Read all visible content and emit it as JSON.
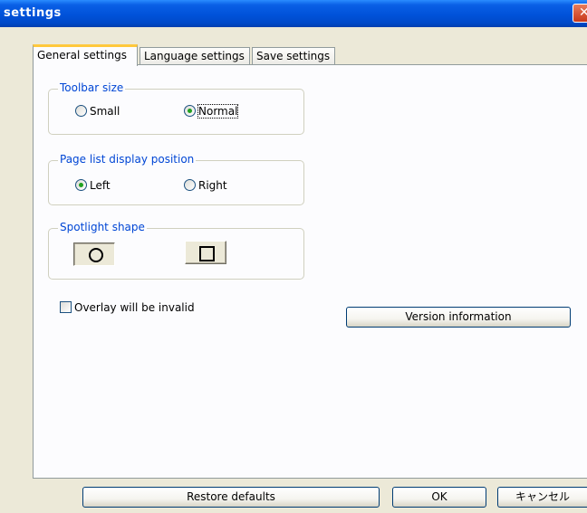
{
  "window": {
    "title": "settings",
    "close_glyph": "✕"
  },
  "tabs": [
    {
      "label": "General settings",
      "active": true
    },
    {
      "label": "Language settings",
      "active": false
    },
    {
      "label": "Save settings",
      "active": false
    }
  ],
  "toolbar_size": {
    "legend": "Toolbar size",
    "options": [
      {
        "label": "Small",
        "selected": false
      },
      {
        "label": "Normal",
        "selected": true
      }
    ]
  },
  "page_list_position": {
    "legend": "Page list display position",
    "options": [
      {
        "label": "Left",
        "selected": true
      },
      {
        "label": "Right",
        "selected": false
      }
    ]
  },
  "spotlight_shape": {
    "legend": "Spotlight shape",
    "options": [
      {
        "shape": "circle-icon",
        "selected": true
      },
      {
        "shape": "square-icon",
        "selected": false
      }
    ]
  },
  "overlay_checkbox": {
    "label": "Overlay will be invalid",
    "checked": false
  },
  "buttons": {
    "version_info": "Version information",
    "restore_defaults": "Restore defaults",
    "ok": "OK",
    "cancel": "キャンセル"
  },
  "colors": {
    "titlebar": "#0052d9",
    "legend_text": "#0046d5",
    "radio_dot": "#21a121",
    "tab_highlight": "#ffc83c",
    "dialog_bg": "#ece9d8"
  }
}
